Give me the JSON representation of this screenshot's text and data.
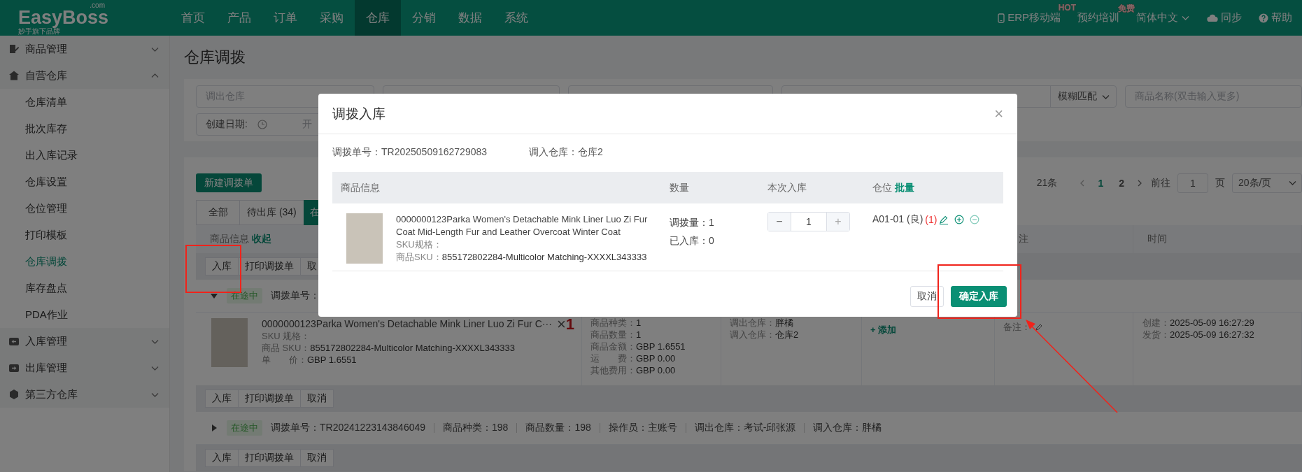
{
  "topbar": {
    "logo": "EasyBoss",
    "logo_suffix": ".com",
    "tagline": "妙手旗下品牌",
    "nav": [
      {
        "label": "首页",
        "selected": false
      },
      {
        "label": "产品",
        "selected": false
      },
      {
        "label": "订单",
        "selected": false
      },
      {
        "label": "采购",
        "selected": false
      },
      {
        "label": "仓库",
        "selected": true
      },
      {
        "label": "分销",
        "selected": false
      },
      {
        "label": "数据",
        "selected": false
      },
      {
        "label": "系统",
        "selected": false
      }
    ],
    "actions": [
      {
        "kind": "mobile",
        "label": "ERP移动端",
        "badge": "HOT"
      },
      {
        "kind": "training",
        "label": "预约培训",
        "badge": "免费"
      },
      {
        "kind": "language",
        "label": "简体中文"
      },
      {
        "kind": "sync",
        "label": "同步"
      },
      {
        "kind": "help",
        "label": "帮助"
      }
    ]
  },
  "sidebar": {
    "groups": [
      {
        "kind": "goods",
        "label": "商品管理",
        "expanded": false
      },
      {
        "kind": "warehouse",
        "label": "自营仓库",
        "expanded": true,
        "children": [
          {
            "label": "仓库清单",
            "selected": false
          },
          {
            "label": "批次库存",
            "selected": false
          },
          {
            "label": "出入库记录",
            "selected": false
          },
          {
            "label": "仓库设置",
            "selected": false
          },
          {
            "label": "仓位管理",
            "selected": false
          },
          {
            "label": "打印模板",
            "selected": false
          },
          {
            "label": "仓库调拨",
            "selected": true
          },
          {
            "label": "库存盘点",
            "selected": false
          },
          {
            "label": "PDA作业",
            "selected": false
          }
        ]
      },
      {
        "kind": "inbound",
        "label": "入库管理",
        "expanded": false
      },
      {
        "kind": "outbound",
        "label": "出库管理",
        "expanded": false
      },
      {
        "kind": "third_party",
        "label": "第三方仓库",
        "expanded": false
      }
    ]
  },
  "page": {
    "title": "仓库调拨",
    "filters": [
      {
        "kind": "field",
        "placeholder": "调出仓库"
      },
      {
        "kind": "field"
      },
      {
        "kind": "field"
      },
      {
        "kind": "combo",
        "value": "模糊匹配"
      },
      {
        "kind": "field",
        "placeholder": "商品名称(双击输入更多)"
      }
    ],
    "date_filter": {
      "label": "创建日期:",
      "start_placeholder": "开"
    },
    "new_button": "新建调拨单",
    "pagination": {
      "total": "21条",
      "pages": [
        {
          "label": "1",
          "selected": true
        },
        {
          "label": "2",
          "selected": false
        }
      ],
      "goto_label": "前往",
      "goto_value": "1",
      "page_unit": "页",
      "page_size": "20条/页"
    },
    "tabs": [
      {
        "label": "全部",
        "selected": false
      },
      {
        "label": "待出库 (34)",
        "selected": false
      },
      {
        "label": "在",
        "selected": true
      }
    ],
    "table_header": {
      "product": "商品信息",
      "toggle": "收起",
      "column_5": "注",
      "column_6": "时间"
    },
    "batch_actions": [
      "入库",
      "打印调拨单",
      "取"
    ],
    "orders": [
      {
        "expanded": true,
        "status": "在途中",
        "fields": [
          "调拨单号："
        ],
        "product": {
          "title": "0000000123Parka Women's Detachable Mink Liner Luo Zi Fur C···",
          "qty_sign": "×",
          "qty": "1",
          "spec_label": "SKU 规格：",
          "sku_label": "商品 SKU：",
          "sku": "855172802284-Multicolor Matching-XXXXL343333",
          "price_label": "单　　价：",
          "price": "GBP 1.6551"
        },
        "stats": [
          {
            "label": "商品种类：",
            "value": "1"
          },
          {
            "label": "商品数量：",
            "value": "1"
          },
          {
            "label": "商品金额：",
            "value": "GBP 1.6551"
          },
          {
            "label": "运　　费：",
            "value": "GBP 0.00"
          },
          {
            "label": "其他费用：",
            "value": "GBP 0.00"
          }
        ],
        "warehouses": [
          {
            "label": "调出仓库：",
            "value": "胖橘"
          },
          {
            "label": "调入仓库：",
            "value": "仓库2"
          }
        ],
        "add_link": "+ 添加",
        "remark_label": "备注：",
        "times": [
          {
            "label": "创建：",
            "value": "2025-05-09 16:27:29"
          },
          {
            "label": "发货：",
            "value": "2025-05-09 16:27:32"
          }
        ],
        "actions": [
          "入库",
          "打印调拨单",
          "取消"
        ]
      },
      {
        "expanded": false,
        "status": "在途中",
        "fields": [
          "调拨单号：TR20241223143846049",
          "商品种类：198",
          "商品数量：198",
          "操作员：主账号",
          "调出仓库：考试-邱张源",
          "调入仓库：胖橘"
        ],
        "actions": [
          "入库",
          "打印调拨单",
          "取消"
        ]
      }
    ]
  },
  "modal": {
    "title": "调拨入库",
    "close": "×",
    "info": [
      {
        "label": "调拨单号：",
        "value": "TR20250509162729083"
      },
      {
        "label": "调入仓库：",
        "value": "仓库2"
      }
    ],
    "columns": [
      {
        "label": "商品信息"
      },
      {
        "label": "数量"
      },
      {
        "label": "本次入库"
      },
      {
        "label": "仓位",
        "link": "批量"
      }
    ],
    "rows": [
      {
        "title": "0000000123Parka Women's Detachable Mink Liner Luo Zi Fur Coat Mid-Length Fur and Leather Overcoat Winter Coat",
        "spec_label": "SKU规格：",
        "sku_label": "商品SKU：",
        "sku": "855172802284-Multicolor Matching-XXXXL343333",
        "quantities": [
          "调拨量：1",
          "已入库：0"
        ],
        "decrement": "−",
        "receive_qty": "1",
        "increment": "+",
        "location": "A01-01 (良)",
        "location_count": "(1)"
      }
    ],
    "buttons": [
      {
        "kind": "default",
        "label": "取消"
      },
      {
        "kind": "primary",
        "label": "确定入库"
      }
    ]
  },
  "annotations": [
    {
      "kind": "box"
    },
    {
      "kind": "box"
    },
    {
      "kind": "arrow"
    }
  ]
}
